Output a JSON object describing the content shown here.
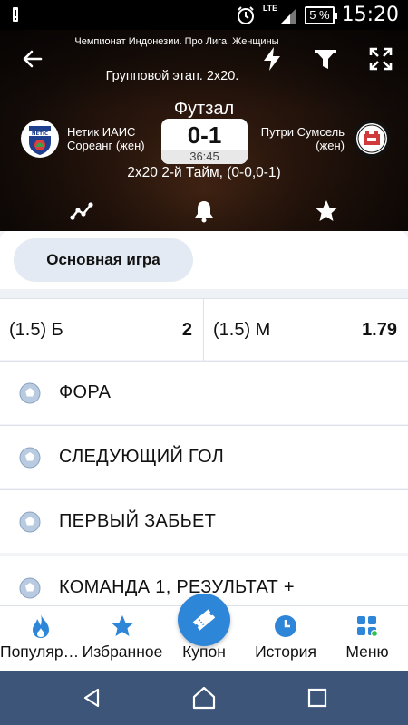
{
  "status_bar": {
    "time": "15:20",
    "battery": "5 %",
    "network": "LTE"
  },
  "match": {
    "league": "Чемпионат Индонезии. Про Лига. Женщины",
    "stage": "Групповой этап. 2х20.",
    "sport": "Футзал",
    "team1": {
      "name": "Нетик ИАИС Сореанг (жен)",
      "logo_text": "NETIC"
    },
    "team2": {
      "name": "Путри Сумсель (жен)"
    },
    "score": "0-1",
    "clock": "36:45",
    "period": "2х20 2-й Тайм, (0-0,0-1)"
  },
  "content": {
    "chip_label": "Основная игра",
    "odds": [
      {
        "label": "(1.5) Б",
        "value": "2"
      },
      {
        "label": "(1.5) М",
        "value": "1.79"
      }
    ],
    "markets": [
      "ФОРА",
      "СЛЕДУЮЩИЙ ГОЛ",
      "ПЕРВЫЙ ЗАБЬЕТ",
      "КОМАНДА 1, РЕЗУЛЬТАТ +"
    ]
  },
  "bottom_nav": [
    {
      "label": "Популярное",
      "icon": "flame-icon"
    },
    {
      "label": "Избранное",
      "icon": "star-icon"
    },
    {
      "label": "Купон",
      "icon": "ticket-icon"
    },
    {
      "label": "История",
      "icon": "clock-icon"
    },
    {
      "label": "Меню",
      "icon": "menu-grid-icon"
    }
  ],
  "colors": {
    "accent": "#2e86d8",
    "chip_bg": "#e3eaf3",
    "system_nav": "#3c5578",
    "ball_icon": "#8aa4c0"
  }
}
